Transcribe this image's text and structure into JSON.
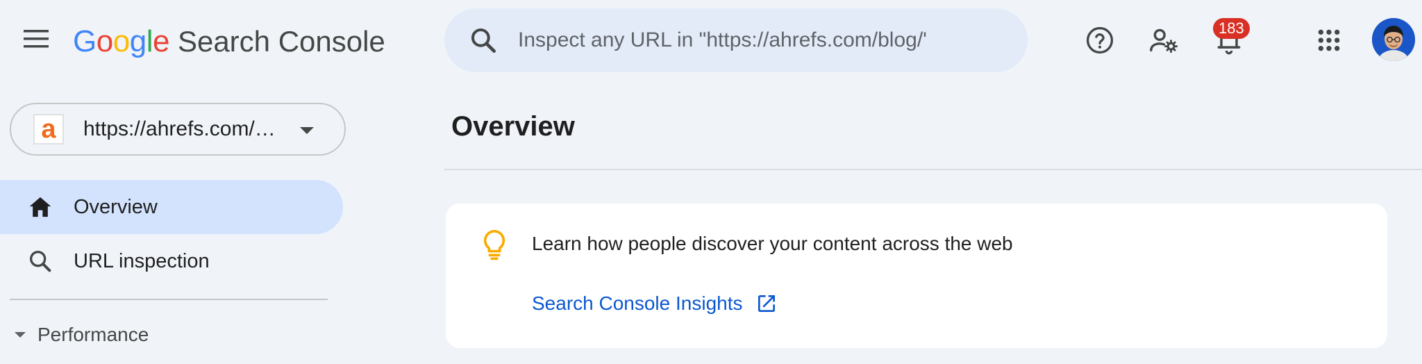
{
  "app": {
    "logo_letters": [
      {
        "ch": "G",
        "color": "#4285F4"
      },
      {
        "ch": "o",
        "color": "#EA4335"
      },
      {
        "ch": "o",
        "color": "#FBBC05"
      },
      {
        "ch": "g",
        "color": "#4285F4"
      },
      {
        "ch": "l",
        "color": "#34A853"
      },
      {
        "ch": "e",
        "color": "#EA4335"
      }
    ],
    "product_name": "Search Console"
  },
  "search": {
    "placeholder": "Inspect any URL in \"https://ahrefs.com/blog/'"
  },
  "notifications": {
    "count": "183",
    "badge_color": "#d93025"
  },
  "property": {
    "label": "https://ahrefs.com/…",
    "favicon_letter": "a",
    "favicon_color": "#f26b1d"
  },
  "sidebar": {
    "items": [
      {
        "label": "Overview",
        "icon": "home-icon",
        "active": true
      },
      {
        "label": "URL inspection",
        "icon": "search-icon",
        "active": false
      }
    ],
    "section": {
      "label": "Performance",
      "icon": "caret-down-icon"
    }
  },
  "main": {
    "title": "Overview",
    "card": {
      "text": "Learn how people discover your content across the web",
      "link_label": "Search Console Insights",
      "link_color": "#0b57d0",
      "icon": "lightbulb-icon"
    }
  },
  "colors": {
    "background": "#f0f4f9",
    "active_nav": "#d3e3fd",
    "search_bg": "#e3ebf8"
  }
}
